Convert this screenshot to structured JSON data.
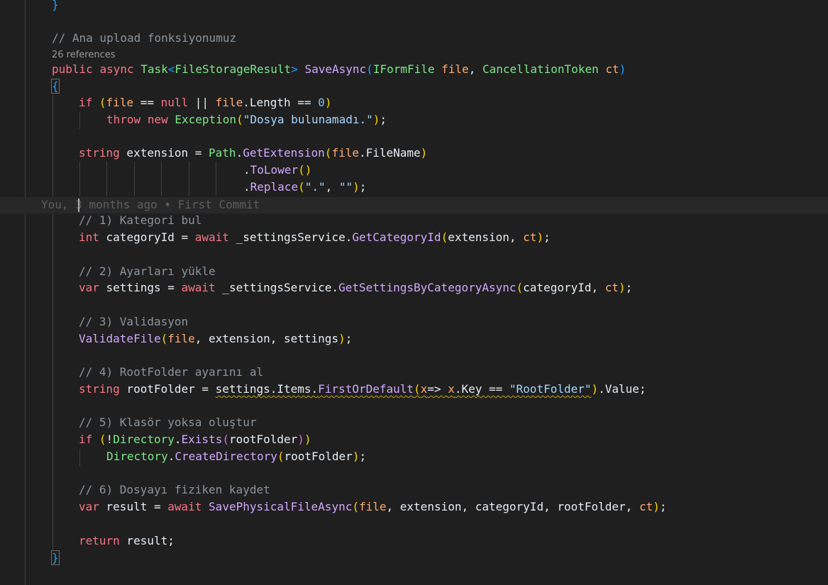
{
  "editor": {
    "codelens": "26 references",
    "blame": "You, 3 months ago • First Commit",
    "lines": [
      {
        "tokens": [
          {
            "t": "}",
            "c": "b3"
          }
        ]
      },
      {
        "tokens": [
          {
            "t": "// Ana upload fonksiyonumuz",
            "c": "cmt"
          }
        ]
      },
      {
        "tokens": [
          {
            "t": "public",
            "c": "kw"
          },
          {
            "t": " ",
            "c": "plain"
          },
          {
            "t": "async",
            "c": "kw"
          },
          {
            "t": " ",
            "c": "plain"
          },
          {
            "t": "Task",
            "c": "type"
          },
          {
            "t": "<",
            "c": "b3"
          },
          {
            "t": "FileStorageResult",
            "c": "type"
          },
          {
            "t": ">",
            "c": "b3"
          },
          {
            "t": " ",
            "c": "plain"
          },
          {
            "t": "SaveAsync",
            "c": "fn"
          },
          {
            "t": "(",
            "c": "b3"
          },
          {
            "t": "IFormFile",
            "c": "type"
          },
          {
            "t": " ",
            "c": "plain"
          },
          {
            "t": "file",
            "c": "var"
          },
          {
            "t": ", ",
            "c": "plain"
          },
          {
            "t": "CancellationToken",
            "c": "type"
          },
          {
            "t": " ",
            "c": "plain"
          },
          {
            "t": "ct",
            "c": "var"
          },
          {
            "t": ")",
            "c": "b3"
          }
        ]
      },
      {
        "tokens": [
          {
            "t": "{",
            "c": "b3"
          }
        ]
      },
      {
        "tokens": [
          {
            "t": "if",
            "c": "kw"
          },
          {
            "t": " ",
            "c": "plain"
          },
          {
            "t": "(",
            "c": "b1"
          },
          {
            "t": "file",
            "c": "var"
          },
          {
            "t": " == ",
            "c": "plain"
          },
          {
            "t": "null",
            "c": "kw"
          },
          {
            "t": " || ",
            "c": "plain"
          },
          {
            "t": "file",
            "c": "var"
          },
          {
            "t": ".Length == ",
            "c": "plain"
          },
          {
            "t": "0",
            "c": "num"
          },
          {
            "t": ")",
            "c": "b1"
          }
        ]
      },
      {
        "tokens": [
          {
            "t": "throw",
            "c": "kw"
          },
          {
            "t": " ",
            "c": "plain"
          },
          {
            "t": "new",
            "c": "kw"
          },
          {
            "t": " ",
            "c": "plain"
          },
          {
            "t": "Exception",
            "c": "type"
          },
          {
            "t": "(",
            "c": "b1"
          },
          {
            "t": "\"Dosya bulunamadı.\"",
            "c": "str"
          },
          {
            "t": ")",
            "c": "b1"
          },
          {
            "t": ";",
            "c": "plain"
          }
        ]
      },
      {
        "tokens": [
          {
            "t": "string",
            "c": "kw"
          },
          {
            "t": " extension = ",
            "c": "plain"
          },
          {
            "t": "Path",
            "c": "type"
          },
          {
            "t": ".",
            "c": "plain"
          },
          {
            "t": "GetExtension",
            "c": "fn"
          },
          {
            "t": "(",
            "c": "b1"
          },
          {
            "t": "file",
            "c": "var"
          },
          {
            "t": ".FileName",
            "c": "plain"
          },
          {
            "t": ")",
            "c": "b1"
          }
        ]
      },
      {
        "tokens": [
          {
            "t": ".",
            "c": "plain"
          },
          {
            "t": "ToLower",
            "c": "fn"
          },
          {
            "t": "()",
            "c": "b1"
          }
        ]
      },
      {
        "tokens": [
          {
            "t": ".",
            "c": "plain"
          },
          {
            "t": "Replace",
            "c": "fn"
          },
          {
            "t": "(",
            "c": "b1"
          },
          {
            "t": "\".\"",
            "c": "str"
          },
          {
            "t": ", ",
            "c": "plain"
          },
          {
            "t": "\"\"",
            "c": "str"
          },
          {
            "t": ")",
            "c": "b1"
          },
          {
            "t": ";",
            "c": "plain"
          }
        ]
      },
      {
        "tokens": [
          {
            "t": "// 1) Kategori bul",
            "c": "cmt"
          }
        ]
      },
      {
        "tokens": [
          {
            "t": "int",
            "c": "kw"
          },
          {
            "t": " categoryId = ",
            "c": "plain"
          },
          {
            "t": "await",
            "c": "kw"
          },
          {
            "t": " _settingsService.",
            "c": "plain"
          },
          {
            "t": "GetCategoryId",
            "c": "fn"
          },
          {
            "t": "(",
            "c": "b1"
          },
          {
            "t": "extension, ",
            "c": "plain"
          },
          {
            "t": "ct",
            "c": "var"
          },
          {
            "t": ")",
            "c": "b1"
          },
          {
            "t": ";",
            "c": "plain"
          }
        ]
      },
      {
        "tokens": [
          {
            "t": "// 2) Ayarları yükle",
            "c": "cmt"
          }
        ]
      },
      {
        "tokens": [
          {
            "t": "var",
            "c": "kw"
          },
          {
            "t": " settings = ",
            "c": "plain"
          },
          {
            "t": "await",
            "c": "kw"
          },
          {
            "t": " _settingsService.",
            "c": "plain"
          },
          {
            "t": "GetSettingsByCategoryAsync",
            "c": "fn"
          },
          {
            "t": "(",
            "c": "b1"
          },
          {
            "t": "categoryId, ",
            "c": "plain"
          },
          {
            "t": "ct",
            "c": "var"
          },
          {
            "t": ")",
            "c": "b1"
          },
          {
            "t": ";",
            "c": "plain"
          }
        ]
      },
      {
        "tokens": [
          {
            "t": "// 3) Validasyon",
            "c": "cmt"
          }
        ]
      },
      {
        "tokens": [
          {
            "t": "ValidateFile",
            "c": "fn"
          },
          {
            "t": "(",
            "c": "b1"
          },
          {
            "t": "file",
            "c": "var"
          },
          {
            "t": ", extension, settings",
            "c": "plain"
          },
          {
            "t": ")",
            "c": "b1"
          },
          {
            "t": ";",
            "c": "plain"
          }
        ]
      },
      {
        "tokens": [
          {
            "t": "// 4) RootFolder ayarını al",
            "c": "cmt"
          }
        ]
      },
      {
        "tokens": [
          {
            "t": "string",
            "c": "kw"
          },
          {
            "t": " rootFolder = ",
            "c": "plain"
          },
          {
            "t": "settings.Items.",
            "c": "plain",
            "sq": true
          },
          {
            "t": "FirstOrDefault",
            "c": "fn",
            "sq": true
          },
          {
            "t": "(",
            "c": "b1",
            "sq": true
          },
          {
            "t": "x",
            "c": "var",
            "sq": true
          },
          {
            "t": "=> ",
            "c": "plain",
            "sq": true
          },
          {
            "t": "x",
            "c": "var",
            "sq": true
          },
          {
            "t": ".Key == ",
            "c": "plain",
            "sq": true
          },
          {
            "t": "\"RootFolder\"",
            "c": "str",
            "sq": true
          },
          {
            "t": ")",
            "c": "b1"
          },
          {
            "t": ".Value;",
            "c": "plain"
          }
        ]
      },
      {
        "tokens": [
          {
            "t": "// 5) Klasör yoksa oluştur",
            "c": "cmt"
          }
        ]
      },
      {
        "tokens": [
          {
            "t": "if",
            "c": "kw"
          },
          {
            "t": " ",
            "c": "plain"
          },
          {
            "t": "(",
            "c": "b1"
          },
          {
            "t": "!",
            "c": "plain"
          },
          {
            "t": "Directory",
            "c": "type"
          },
          {
            "t": ".",
            "c": "plain"
          },
          {
            "t": "Exists",
            "c": "fn"
          },
          {
            "t": "(",
            "c": "b2"
          },
          {
            "t": "rootFolder",
            "c": "plain"
          },
          {
            "t": ")",
            "c": "b2"
          },
          {
            "t": ")",
            "c": "b1"
          }
        ]
      },
      {
        "tokens": [
          {
            "t": "Directory",
            "c": "type"
          },
          {
            "t": ".",
            "c": "plain"
          },
          {
            "t": "CreateDirectory",
            "c": "fn"
          },
          {
            "t": "(",
            "c": "b1"
          },
          {
            "t": "rootFolder",
            "c": "plain"
          },
          {
            "t": ")",
            "c": "b1"
          },
          {
            "t": ";",
            "c": "plain"
          }
        ]
      },
      {
        "tokens": [
          {
            "t": "// 6) Dosyayı fiziken kaydet",
            "c": "cmt"
          }
        ]
      },
      {
        "tokens": [
          {
            "t": "var",
            "c": "kw"
          },
          {
            "t": " result = ",
            "c": "plain"
          },
          {
            "t": "await",
            "c": "kw"
          },
          {
            "t": " ",
            "c": "plain"
          },
          {
            "t": "SavePhysicalFileAsync",
            "c": "fn"
          },
          {
            "t": "(",
            "c": "b1"
          },
          {
            "t": "file",
            "c": "var"
          },
          {
            "t": ", extension, categoryId, rootFolder, ",
            "c": "plain"
          },
          {
            "t": "ct",
            "c": "var"
          },
          {
            "t": ")",
            "c": "b1"
          },
          {
            "t": ";",
            "c": "plain"
          }
        ]
      },
      {
        "tokens": [
          {
            "t": "return",
            "c": "kw"
          },
          {
            "t": " result;",
            "c": "plain"
          }
        ]
      },
      {
        "tokens": [
          {
            "t": "}",
            "c": "b3"
          }
        ]
      }
    ]
  }
}
